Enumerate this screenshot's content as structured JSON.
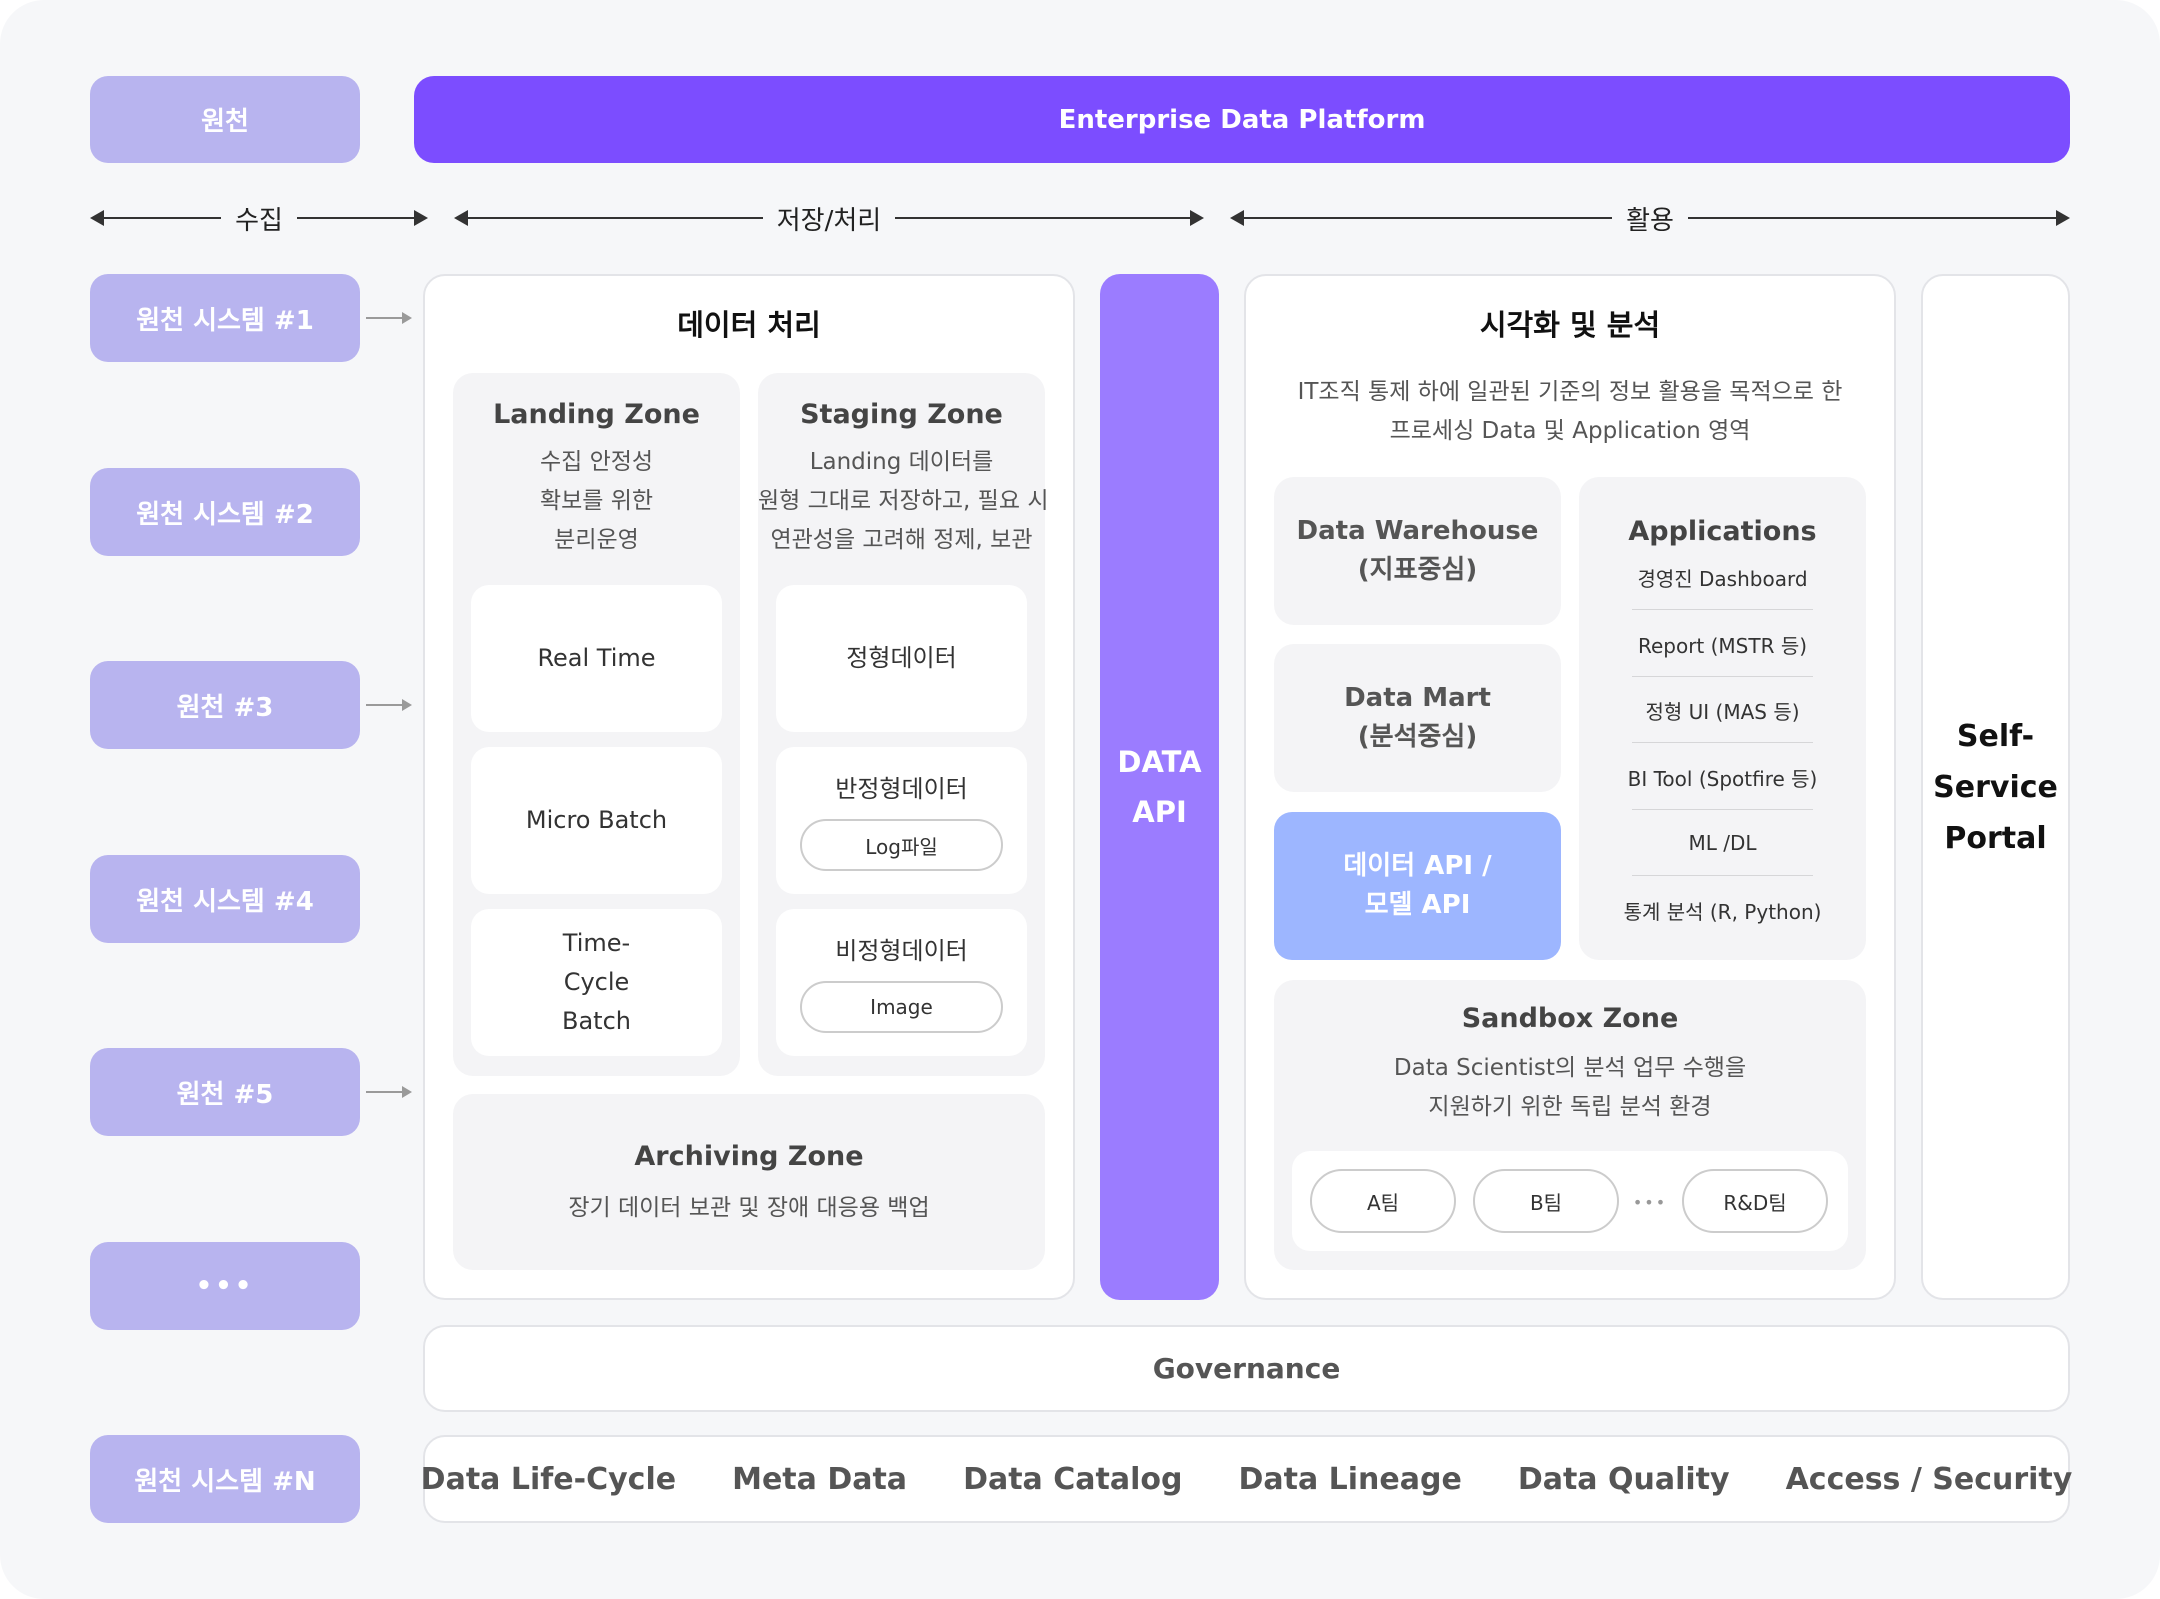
{
  "header": {
    "source": "원천",
    "platform": "Enterprise Data Platform"
  },
  "phases": {
    "collect": "수집",
    "store": "저장/처리",
    "use": "활용"
  },
  "sources": [
    "원천 시스템 #1",
    "원천 시스템 #2",
    "원천 #3",
    "원천 시스템 #4",
    "원천 #5",
    "•••",
    "원천 시스템 #N"
  ],
  "processing": {
    "title": "데이터 처리",
    "landing": {
      "title": "Landing Zone",
      "desc": [
        "수집 안정성",
        "확보를 위한",
        "분리운영"
      ],
      "items": [
        "Real Time",
        "Micro Batch",
        "Time-Cycle Batch"
      ]
    },
    "staging": {
      "title": "Staging Zone",
      "desc": [
        "Landing 데이터를",
        "원형 그대로 저장하고, 필요 시",
        "연관성을 고려해 정제, 보관"
      ],
      "structured": "정형데이터",
      "semi": "반정형데이터",
      "semi_chip": "Log파일",
      "unstructured": "비정형데이터",
      "unstructured_chip": "Image"
    },
    "archiving": {
      "title": "Archiving Zone",
      "desc": "장기 데이터 보관 및 장애 대응용 백업"
    }
  },
  "data_api": [
    "DATA",
    "API"
  ],
  "visualization": {
    "title": "시각화 및 분석",
    "desc": [
      "IT조직 통제 하에 일관된 기준의 정보 활용을 목적으로 한",
      "프로세싱 Data 및 Application 영역"
    ],
    "warehouse": [
      "Data Warehouse",
      "(지표중심)"
    ],
    "mart": [
      "Data Mart",
      "(분석중심)"
    ],
    "api_card": [
      "데이터 API /",
      "모델 API"
    ],
    "applications": {
      "title": "Applications",
      "items": [
        "경영진 Dashboard",
        "Report (MSTR 등)",
        "정형 UI (MAS 등)",
        "BI Tool (Spotfire 등)",
        "ML /DL",
        "통계 분석 (R, Python)"
      ]
    },
    "sandbox": {
      "title": "Sandbox Zone",
      "desc": [
        "Data Scientist의 분석 업무 수행을",
        "지원하기 위한 독립 분석 환경"
      ],
      "teams": [
        "A팀",
        "B팀",
        "•••",
        "R&D팀"
      ]
    }
  },
  "self_service": [
    "Self-",
    "Service",
    "Portal"
  ],
  "governance": {
    "title": "Governance",
    "items": [
      "Data Life-Cycle",
      "Meta Data",
      "Data Catalog",
      "Data Lineage",
      "Data Quality",
      "Access / Security"
    ]
  },
  "colors": {
    "primary": "#7c4dff",
    "source_pill": "#b8b4ef",
    "data_api": "#9b7cff",
    "api_card": "#9db6ff"
  }
}
